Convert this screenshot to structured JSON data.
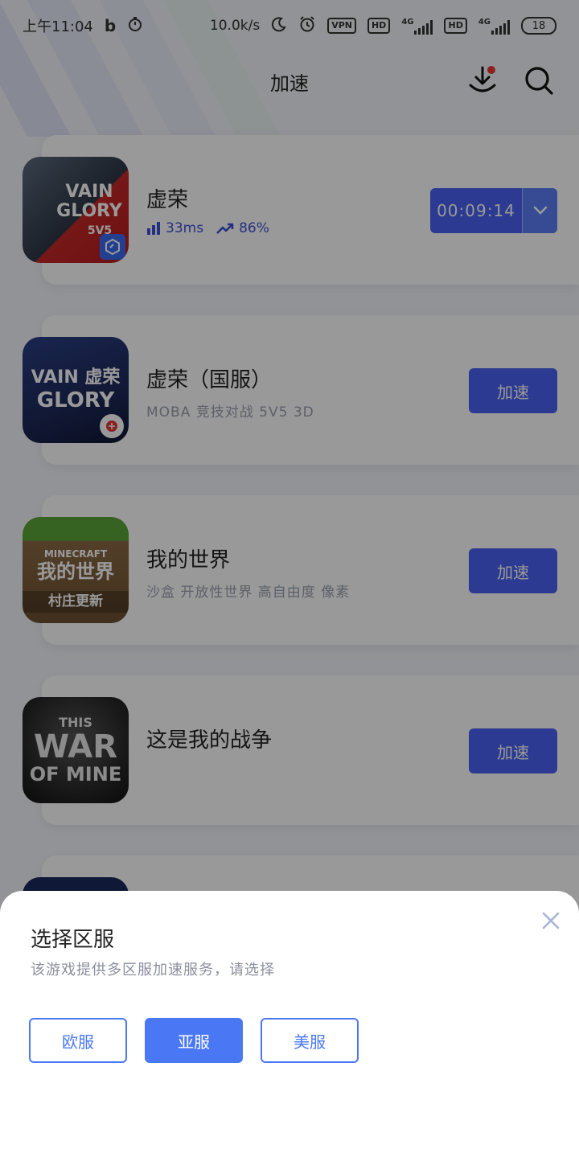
{
  "status_bar": {
    "time": "上午11:04",
    "net_speed": "10.0k/s",
    "vpn": "VPN",
    "hd1": "HD",
    "sig1_type": "4G",
    "hd2": "HD",
    "sig2_type": "4G",
    "battery": "18"
  },
  "header": {
    "title": "加速",
    "has_download_badge": true
  },
  "games": [
    {
      "name": "虚荣",
      "icon_text_1": "VAIN",
      "icon_text_2": "GLORY",
      "icon_text_3": "5V5",
      "ping": "33ms",
      "boost": "86%",
      "timer": "00:09:14",
      "state": "running"
    },
    {
      "name": "虚荣（国服）",
      "icon_text_1": "VAIN 虚荣",
      "icon_text_2": "GLORY",
      "tags": "MOBA  竞技对战  5V5  3D",
      "button": "加速"
    },
    {
      "name": "我的世界",
      "icon_text_1": "MINECRAFT",
      "icon_text_2": "我的世界",
      "icon_text_3": "村庄更新",
      "tags": "沙盒  开放性世界  高自由度  像素",
      "button": "加速"
    },
    {
      "name": "这是我的战争",
      "icon_text_1": "THIS",
      "icon_text_2": "WAR",
      "icon_text_3": "OF MINE",
      "button": "加速"
    }
  ],
  "sheet": {
    "title": "选择区服",
    "subtitle": "该游戏提供多区服加速服务，请选择",
    "regions": [
      "欧服",
      "亚服",
      "美服"
    ],
    "selected": "亚服"
  },
  "colors": {
    "accent": "#4a63f2",
    "region_accent": "#4a78f5"
  }
}
